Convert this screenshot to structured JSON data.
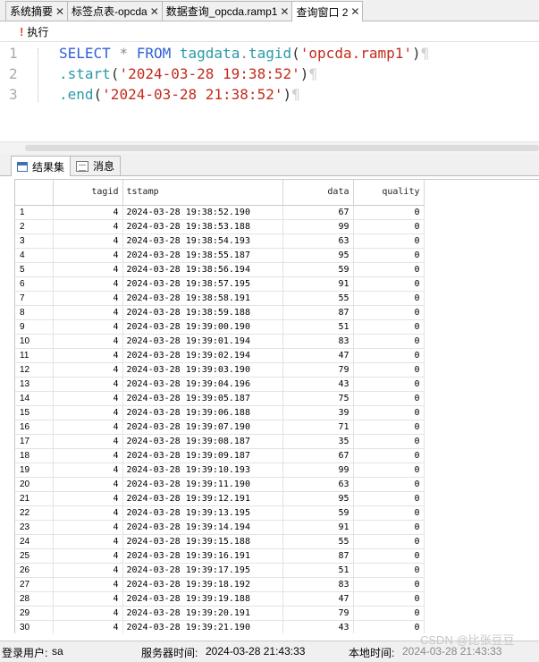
{
  "tabs": [
    {
      "label": "系统摘要",
      "active": false
    },
    {
      "label": "标签点表-opcda",
      "active": false
    },
    {
      "label": "数据查询_opcda.ramp1",
      "active": false
    },
    {
      "label": "查询窗口 2",
      "active": true
    }
  ],
  "toolbar": {
    "execute_label": "执行"
  },
  "editor": {
    "line_numbers": [
      "1",
      "2",
      "3"
    ],
    "line1": {
      "kw1": "SELECT",
      "star": "*",
      "kw2": "FROM",
      "obj": "tagdata",
      "dot": ".",
      "fn": "tagid",
      "open": "(",
      "arg": "'opcda.ramp1'",
      "close": ")",
      "mark": "¶"
    },
    "line2": {
      "fn": ".start",
      "open": "(",
      "arg": "'2024-03-28 19:38:52'",
      "close": ")",
      "mark": "¶"
    },
    "line3": {
      "fn": ".end",
      "open": "(",
      "arg": "'2024-03-28 21:38:52'",
      "close": ")",
      "mark": "¶"
    }
  },
  "result_tabs": {
    "results": "结果集",
    "messages": "消息"
  },
  "grid": {
    "columns": [
      "",
      "tagid",
      "tstamp",
      "data",
      "quality"
    ],
    "rows": [
      [
        "1",
        "4",
        "2024-03-28 19:38:52.190",
        "67",
        "0"
      ],
      [
        "2",
        "4",
        "2024-03-28 19:38:53.188",
        "99",
        "0"
      ],
      [
        "3",
        "4",
        "2024-03-28 19:38:54.193",
        "63",
        "0"
      ],
      [
        "4",
        "4",
        "2024-03-28 19:38:55.187",
        "95",
        "0"
      ],
      [
        "5",
        "4",
        "2024-03-28 19:38:56.194",
        "59",
        "0"
      ],
      [
        "6",
        "4",
        "2024-03-28 19:38:57.195",
        "91",
        "0"
      ],
      [
        "7",
        "4",
        "2024-03-28 19:38:58.191",
        "55",
        "0"
      ],
      [
        "8",
        "4",
        "2024-03-28 19:38:59.188",
        "87",
        "0"
      ],
      [
        "9",
        "4",
        "2024-03-28 19:39:00.190",
        "51",
        "0"
      ],
      [
        "10",
        "4",
        "2024-03-28 19:39:01.194",
        "83",
        "0"
      ],
      [
        "11",
        "4",
        "2024-03-28 19:39:02.194",
        "47",
        "0"
      ],
      [
        "12",
        "4",
        "2024-03-28 19:39:03.190",
        "79",
        "0"
      ],
      [
        "13",
        "4",
        "2024-03-28 19:39:04.196",
        "43",
        "0"
      ],
      [
        "14",
        "4",
        "2024-03-28 19:39:05.187",
        "75",
        "0"
      ],
      [
        "15",
        "4",
        "2024-03-28 19:39:06.188",
        "39",
        "0"
      ],
      [
        "16",
        "4",
        "2024-03-28 19:39:07.190",
        "71",
        "0"
      ],
      [
        "17",
        "4",
        "2024-03-28 19:39:08.187",
        "35",
        "0"
      ],
      [
        "18",
        "4",
        "2024-03-28 19:39:09.187",
        "67",
        "0"
      ],
      [
        "19",
        "4",
        "2024-03-28 19:39:10.193",
        "99",
        "0"
      ],
      [
        "20",
        "4",
        "2024-03-28 19:39:11.190",
        "63",
        "0"
      ],
      [
        "21",
        "4",
        "2024-03-28 19:39:12.191",
        "95",
        "0"
      ],
      [
        "22",
        "4",
        "2024-03-28 19:39:13.195",
        "59",
        "0"
      ],
      [
        "23",
        "4",
        "2024-03-28 19:39:14.194",
        "91",
        "0"
      ],
      [
        "24",
        "4",
        "2024-03-28 19:39:15.188",
        "55",
        "0"
      ],
      [
        "25",
        "4",
        "2024-03-28 19:39:16.191",
        "87",
        "0"
      ],
      [
        "26",
        "4",
        "2024-03-28 19:39:17.195",
        "51",
        "0"
      ],
      [
        "27",
        "4",
        "2024-03-28 19:39:18.192",
        "83",
        "0"
      ],
      [
        "28",
        "4",
        "2024-03-28 19:39:19.188",
        "47",
        "0"
      ],
      [
        "29",
        "4",
        "2024-03-28 19:39:20.191",
        "79",
        "0"
      ],
      [
        "30",
        "4",
        "2024-03-28 19:39:21.190",
        "43",
        "0"
      ]
    ]
  },
  "status": {
    "user_label": "登录用户:",
    "user": "sa",
    "server_time_label": "服务器时间:",
    "server_time": "2024-03-28 21:43:33",
    "local_time_label": "本地时间:",
    "local_time": "2024-03-28 21:43:33",
    "watermark": "CSDN @比张豆豆"
  }
}
